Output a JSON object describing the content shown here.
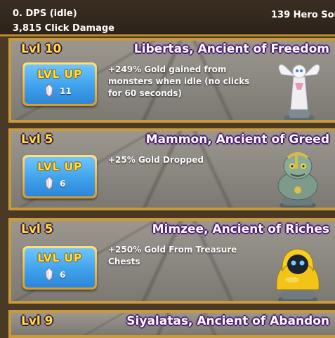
{
  "header": {
    "dps": "0. DPS (idle)",
    "click_damage": "3,815 Click Damage",
    "hero_souls": "139 Hero Sou"
  },
  "ancients": [
    {
      "level": "Lvl 10",
      "name": "Libertas, Ancient of Freedom",
      "description": "+249% Gold gained from monsters when idle (no clicks for 60 seconds)",
      "button_label": "LVL UP",
      "cost": "11",
      "portrait_icon": "libertas-statue-icon"
    },
    {
      "level": "Lvl 5",
      "name": "Mammon, Ancient of Greed",
      "description": "+25% Gold Dropped",
      "button_label": "LVL UP",
      "cost": "6",
      "portrait_icon": "mammon-statue-icon"
    },
    {
      "level": "Lvl 5",
      "name": "Mimzee, Ancient of Riches",
      "description": "+250% Gold From Treasure Chests",
      "button_label": "LVL UP",
      "cost": "6",
      "portrait_icon": "mimzee-statue-icon"
    },
    {
      "level": "Lvl 9",
      "name": "Siyalatas, Ancient of Abandon"
    }
  ],
  "colors": {
    "border_gold": "#c99a3a",
    "level_yellow": "#ffe23a",
    "button_blue": "#3fa1ec",
    "name_outline": "#4b1a6e"
  }
}
